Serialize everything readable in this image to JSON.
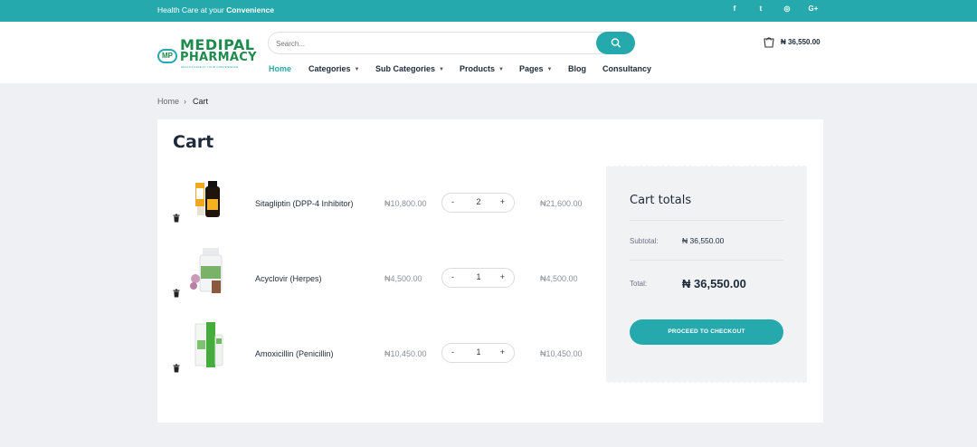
{
  "topbar": {
    "tagline_prefix": "Health Care at your ",
    "tagline_bold": "Convenience",
    "social": [
      {
        "icon": "facebook-icon",
        "glyph": "f"
      },
      {
        "icon": "twitter-icon",
        "glyph": "t"
      },
      {
        "icon": "instagram-icon",
        "glyph": "◎"
      },
      {
        "icon": "google-plus-icon",
        "glyph": "G+"
      }
    ]
  },
  "logo": {
    "line1": "MEDIPAL",
    "line2": "PHARMACY",
    "badge": "MP",
    "sub": "HEALTH CARE AT YOUR CONVENIENCE"
  },
  "search": {
    "placeholder": "Search..."
  },
  "nav": [
    {
      "label": "Home",
      "active": true,
      "dropdown": false
    },
    {
      "label": "Categories",
      "active": false,
      "dropdown": true
    },
    {
      "label": "Sub Categories",
      "active": false,
      "dropdown": true
    },
    {
      "label": "Products",
      "active": false,
      "dropdown": true
    },
    {
      "label": "Pages",
      "active": false,
      "dropdown": true
    },
    {
      "label": "Blog",
      "active": false,
      "dropdown": false
    },
    {
      "label": "Consultancy",
      "active": false,
      "dropdown": false
    }
  ],
  "header_cart": {
    "total": "₦ 36,550.00"
  },
  "breadcrumb": {
    "home": "Home",
    "separator": "›",
    "current": "Cart"
  },
  "page": {
    "title": "Cart"
  },
  "cart_items": [
    {
      "name": "Sitagliptin (DPP-4 Inhibitor)",
      "price": "₦10,800.00",
      "qty": "2",
      "line_total": "₦21,600.00"
    },
    {
      "name": "Acyclovir (Herpes)",
      "price": "₦4,500.00",
      "qty": "1",
      "line_total": "₦4,500.00"
    },
    {
      "name": "Amoxicillin (Penicillin)",
      "price": "₦10,450.00",
      "qty": "1",
      "line_total": "₦10,450.00"
    }
  ],
  "qty_controls": {
    "minus": "-",
    "plus": "+"
  },
  "totals": {
    "heading": "Cart totals",
    "subtotal_label": "Subtotal:",
    "subtotal_value": "₦ 36,550.00",
    "total_label": "Total:",
    "total_value": "₦ 36,550.00",
    "checkout_label": "PROCEED TO CHECKOUT"
  },
  "colors": {
    "accent": "#26a9ad",
    "brand_green": "#1e8b4e",
    "background": "#eef0f3"
  }
}
